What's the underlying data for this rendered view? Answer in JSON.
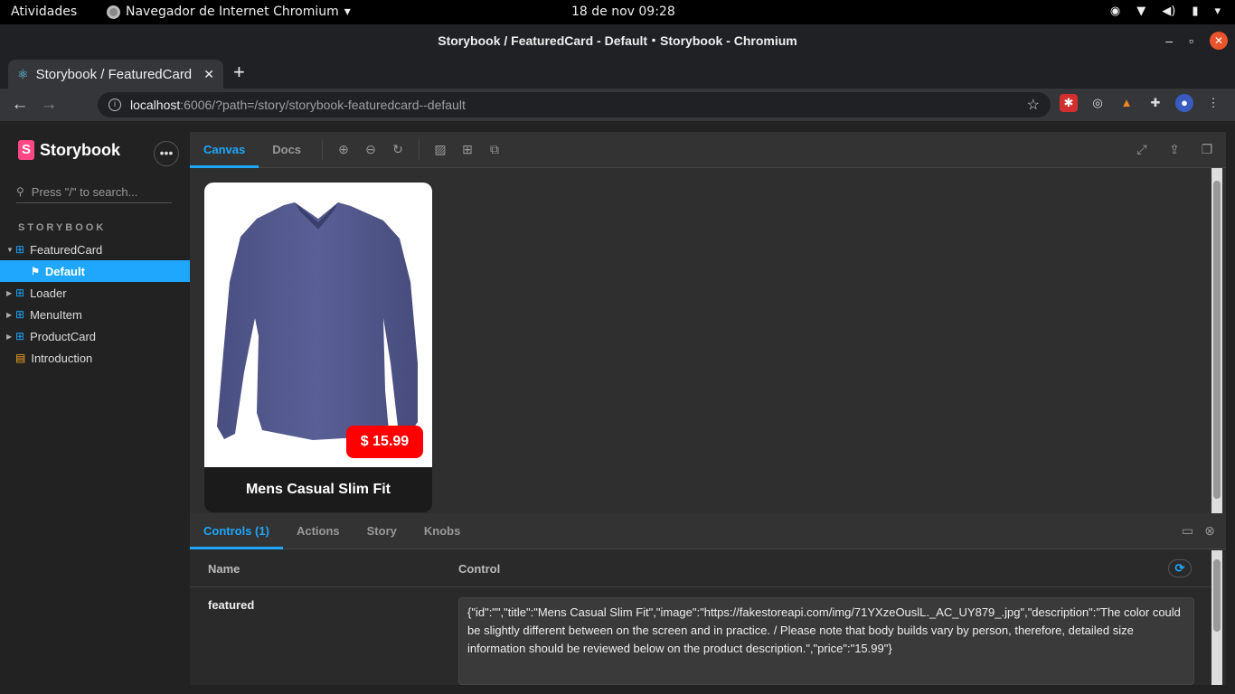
{
  "os": {
    "activities": "Atividades",
    "app_name": "Navegador de Internet Chromium",
    "clock": "18 de nov  09:28"
  },
  "window": {
    "title": "Storybook / FeaturedCard - Default・Storybook - Chromium"
  },
  "tab": {
    "label": "Storybook / FeaturedCard",
    "close": "✕"
  },
  "address": {
    "host": "localhost",
    "path": ":6006/?path=/story/storybook-featuredcard--default"
  },
  "sidebar": {
    "brand": "Storybook",
    "search_placeholder": "Press \"/\" to search...",
    "section": "STORYBOOK",
    "items": [
      {
        "label": "FeaturedCard"
      },
      {
        "label": "Default"
      },
      {
        "label": "Loader"
      },
      {
        "label": "MenuItem"
      },
      {
        "label": "ProductCard"
      },
      {
        "label": "Introduction"
      }
    ]
  },
  "preview_tabs": {
    "canvas": "Canvas",
    "docs": "Docs"
  },
  "card": {
    "price": "$ 15.99",
    "title": "Mens Casual Slim Fit"
  },
  "addons": {
    "tabs": [
      "Controls (1)",
      "Actions",
      "Story",
      "Knobs"
    ]
  },
  "controls": {
    "col_name": "Name",
    "col_control": "Control",
    "row_name": "featured",
    "row_value": "{\"id\":\"\",\"title\":\"Mens Casual Slim Fit\",\"image\":\"https://fakestoreapi.com/img/71YXzeOuslL._AC_UY879_.jpg\",\"description\":\"The color could be slightly different between on the screen and in practice. / Please note that body builds vary by person, therefore, detailed size information should be reviewed below on the product description.\",\"price\":\"15.99\"}"
  },
  "colors": {
    "accent": "#1ea7fd",
    "brand": "#ff4785",
    "price_badge": "#ff0000"
  }
}
